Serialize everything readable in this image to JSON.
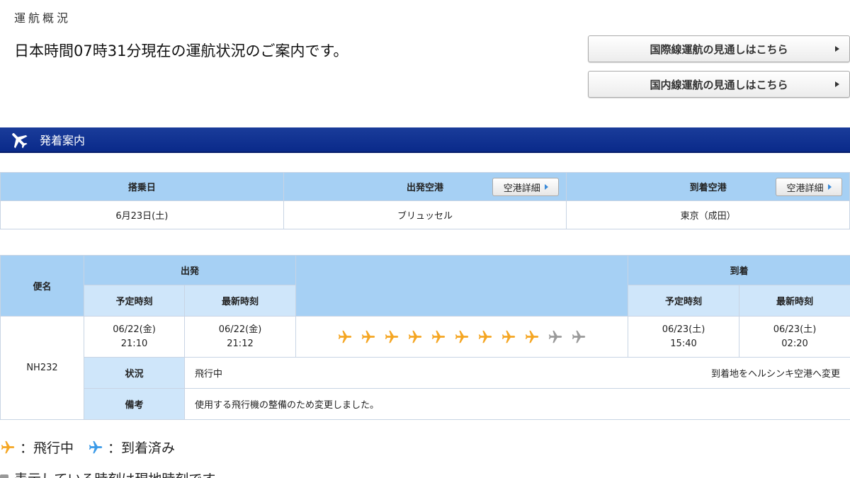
{
  "header": {
    "section_title": "運航概況",
    "status_time": "日本時間07時31分現在の運航状況のご案内です。"
  },
  "buttons": {
    "international": "国際線運航の見通しはこちら",
    "domestic": "国内線運航の見通しはこちら"
  },
  "banner": {
    "label": "発着案内"
  },
  "airport_table": {
    "boarding_date_label": "搭乗日",
    "departure_airport_label": "出発空港",
    "arrival_airport_label": "到着空港",
    "detail_button": "空港詳細",
    "boarding_date": "6月23日(土)",
    "departure_airport": "ブリュッセル",
    "arrival_airport": "東京（成田）"
  },
  "flight_table": {
    "flight_no_label": "便名",
    "departure_label": "出発",
    "arrival_label": "到着",
    "scheduled_label": "予定時刻",
    "latest_label": "最新時刻",
    "flight_no": "NH232",
    "dep_scheduled_date": "06/22(金)",
    "dep_scheduled_time": "21:10",
    "dep_latest_date": "06/22(金)",
    "dep_latest_time": "21:12",
    "arr_scheduled_date": "06/23(土)",
    "arr_scheduled_time": "15:40",
    "arr_latest_date": "06/23(土)",
    "arr_latest_time": "02:20",
    "status_label": "状況",
    "status_value": "飛行中",
    "status_note": "到着地をヘルシンキ空港へ変更",
    "remarks_label": "備考",
    "remarks_value": "使用する飛行機の整備のため変更しました。",
    "progress": {
      "total": 11,
      "completed": 9
    }
  },
  "legend": {
    "in_flight": "：飛行中",
    "arrived": "：到着済み"
  },
  "note": "表示している時刻は現地時刻です。",
  "colors": {
    "in_flight_plane": "#f5a623",
    "arrived_plane": "#3a9ae8",
    "pending_plane": "#9a9a9a",
    "banner": "#0d2f8f",
    "header_cell": "#a6d0f4",
    "subheader_cell": "#cfe6fa"
  }
}
